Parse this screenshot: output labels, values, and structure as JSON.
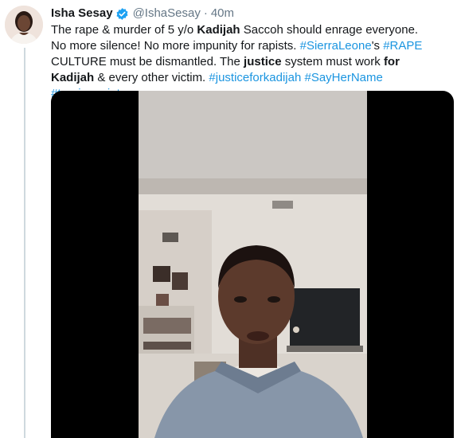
{
  "tweet": {
    "display_name": "Isha Sesay",
    "handle": "@IshaSesay",
    "separator": "·",
    "time": "40m",
    "text": {
      "p1": "The rape & murder of 5 y/o ",
      "b1": "Kadijah",
      "p2": " Saccoh should enrage everyone. No more silence! No more impunity for rapists. ",
      "tag1": "#SierraLeone",
      "p3": "'s ",
      "tag2": "#RAPE",
      "p4": " CULTURE must be dismantled. The ",
      "b2": "justice",
      "p5": " system must work ",
      "b3": "for Kadijah",
      "p6": " & every other victim. ",
      "tag3": "#justiceforkadijah",
      "sp1": " ",
      "tag4": "#SayHerName",
      "sp2": " ",
      "tag5": "#turningpoint"
    }
  },
  "icons": {
    "verified": "verified-badge-icon",
    "avatar": "profile-avatar"
  },
  "colors": {
    "link": "#1b95e0",
    "text": "#14171a",
    "secondary": "#657786",
    "verified": "#1da1f2",
    "thread_line": "#cfd9de"
  }
}
